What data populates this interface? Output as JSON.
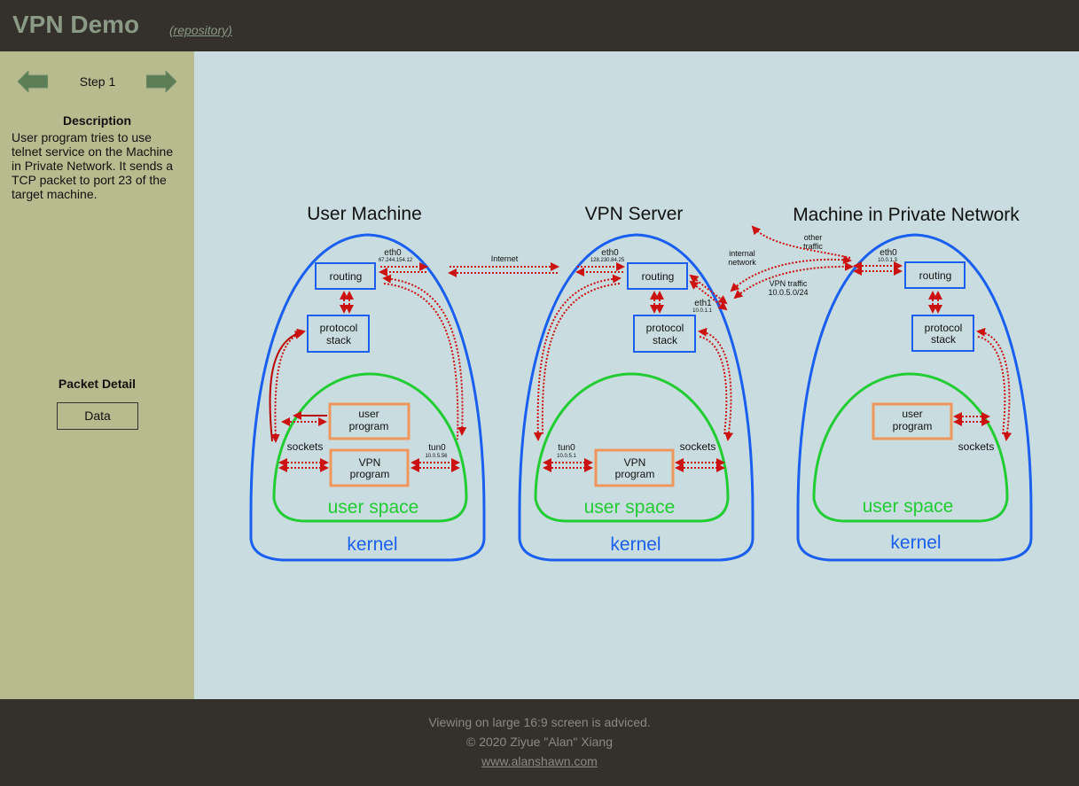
{
  "header": {
    "title": "VPN Demo",
    "repo_link": "(repository)"
  },
  "sidebar": {
    "step_label": "Step 1",
    "description_title": "Description",
    "description": "User program tries to use telnet service on the Machine in Private Network. It sends a TCP packet to port 23 of the target machine.",
    "packet_detail_title": "Packet Detail",
    "packet_field": "Data"
  },
  "diagram": {
    "user_machine": {
      "title": "User Machine",
      "eth0": "eth0",
      "eth0_ip": "67.244.154.12",
      "routing": "routing",
      "protocol_line1": "protocol",
      "protocol_line2": "stack",
      "user_program_line1": "user",
      "user_program_line2": "program",
      "sockets": "sockets",
      "tun0": "tun0",
      "tun0_ip": "10.0.5.56",
      "vpn_program_line1": "VPN",
      "vpn_program_line2": "program",
      "user_space": "user space",
      "kernel": "kernel"
    },
    "vpn_server": {
      "title": "VPN Server",
      "eth0": "eth0",
      "eth0_ip": "128.230.84.25",
      "routing": "routing",
      "eth1": "eth1",
      "eth1_ip": "10.0.1.1",
      "protocol_line1": "protocol",
      "protocol_line2": "stack",
      "tun0": "tun0",
      "tun0_ip": "10.0.5.1",
      "sockets": "sockets",
      "vpn_program_line1": "VPN",
      "vpn_program_line2": "program",
      "user_space": "user space",
      "kernel": "kernel"
    },
    "private_machine": {
      "title": "Machine in Private Network",
      "eth0": "eth0",
      "eth0_ip": "10.0.1.3",
      "routing": "routing",
      "protocol_line1": "protocol",
      "protocol_line2": "stack",
      "user_program_line1": "user",
      "user_program_line2": "program",
      "sockets": "sockets",
      "user_space": "user space",
      "kernel": "kernel"
    },
    "links": {
      "internet": "Internet",
      "internal_line1": "internal",
      "internal_line2": "network",
      "other_line1": "other",
      "other_line2": "traffic",
      "vpn_traffic_line1": "VPN traffic",
      "vpn_traffic_line2": "10.0.5.0/24"
    },
    "colors": {
      "kernel": "#1a5ff0",
      "user_space": "#22cc33",
      "program_box": "#f0965a",
      "arrow": "#cc1111",
      "active_arrow": "#bb0000"
    }
  },
  "footer": {
    "advice": "Viewing on large 16:9 screen is adviced.",
    "copyright": "© 2020 Ziyue \"Alan\" Xiang",
    "website": "www.alanshawn.com"
  }
}
